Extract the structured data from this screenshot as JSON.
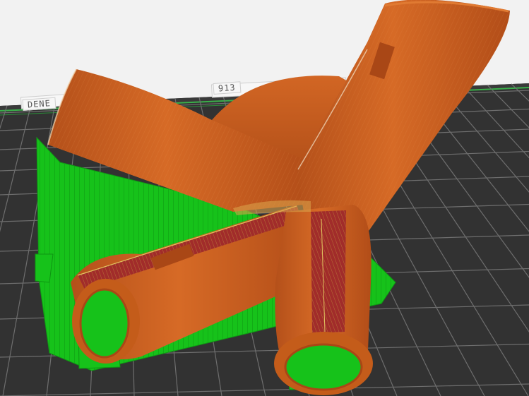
{
  "viewer": {
    "bed_label_left": "DENE",
    "bed_label_right": "913",
    "colors": {
      "background": "#f2f2f2",
      "bed_surface": "#323232",
      "bed_grid": "#6e6e6e",
      "bed_edge_highlight": "#3ab04a",
      "model_shell": "#c45c1a",
      "model_shell_highlight": "#e07a32",
      "model_infill": "#a12c2a",
      "support": "#16c21a",
      "support_dark": "#0f9a14",
      "overhang_yellow": "#d8c24a"
    },
    "objects": [
      {
        "name": "model",
        "type": "sliced-tube-junction",
        "tube_count": 4
      },
      {
        "name": "support-structures",
        "type": "support"
      }
    ]
  }
}
